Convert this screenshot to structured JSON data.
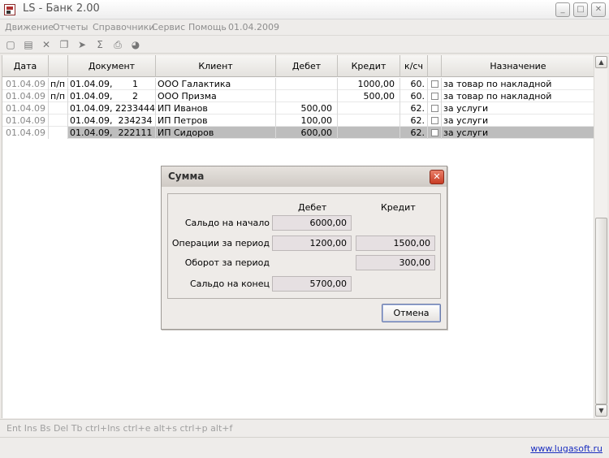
{
  "window": {
    "title": "LS - Банк 2.00",
    "min_label": "_",
    "max_label": "□",
    "close_label": "✕"
  },
  "menu": {
    "items": [
      "Движение",
      "Отчеты",
      "Справочники",
      "Сервис",
      "Помощь",
      "01.04.2009"
    ]
  },
  "toolbar": {
    "icons": [
      {
        "name": "new-document-icon",
        "glyph": "▢"
      },
      {
        "name": "open-folder-icon",
        "glyph": "▤"
      },
      {
        "name": "delete-icon",
        "glyph": "✕"
      },
      {
        "name": "copy-icon",
        "glyph": "❐"
      },
      {
        "name": "move-icon",
        "glyph": "➤"
      },
      {
        "name": "sum-icon",
        "glyph": "Σ"
      },
      {
        "name": "print-icon",
        "glyph": "⎙"
      },
      {
        "name": "chart-icon",
        "glyph": "◕"
      }
    ]
  },
  "table": {
    "columns": [
      "Дата",
      "",
      "Документ",
      "Клиент",
      "Дебет",
      "Кредит",
      "к/сч",
      "",
      "Назначение"
    ],
    "rows": [
      {
        "date": "01.04.09",
        "type": "п/п",
        "doc": "01.04.09,       1",
        "client": "ООО Галактика",
        "debit": "",
        "credit": "1000,00",
        "account": "60.",
        "purpose": "за товар по накладной",
        "selected": false
      },
      {
        "date": "01.04.09",
        "type": "п/п",
        "doc": "01.04.09,       2",
        "client": "ООО Призма",
        "debit": "",
        "credit": "500,00",
        "account": "60.",
        "purpose": "за товар по накладной",
        "selected": false
      },
      {
        "date": "01.04.09",
        "type": "",
        "doc": "01.04.09, 2233444",
        "client": "ИП Иванов",
        "debit": "500,00",
        "credit": "",
        "account": "62.",
        "purpose": "за услуги",
        "selected": false
      },
      {
        "date": "01.04.09",
        "type": "",
        "doc": "01.04.09,  234234",
        "client": "ИП Петров",
        "debit": "100,00",
        "credit": "",
        "account": "62.",
        "purpose": "за услуги",
        "selected": false
      },
      {
        "date": "01.04.09",
        "type": "",
        "doc": "01.04.09,  222111",
        "client": "ИП Сидоров",
        "debit": "600,00",
        "credit": "",
        "account": "62.",
        "purpose": "за услуги",
        "selected": true
      }
    ]
  },
  "scrollbar": {
    "up": "▲",
    "down": "▼"
  },
  "keys_hint": "Ent  Ins  Bs Del Tb ctrl+Ins ctrl+e  alt+s ctrl+p alt+f",
  "status": {
    "link": "www.lugasoft.ru"
  },
  "dialog": {
    "title": "Сумма",
    "close_label": "✕",
    "debit_header": "Дебет",
    "credit_header": "Кредит",
    "rows": [
      {
        "label": "Сальдо на начало",
        "debit": "6000,00",
        "credit": ""
      },
      {
        "label": "Операции за период",
        "debit": "1200,00",
        "credit": "1500,00"
      },
      {
        "label": "Оборот за период",
        "debit": "",
        "credit": "300,00"
      },
      {
        "label": "Сальдо на конец",
        "debit": "5700,00",
        "credit": ""
      }
    ],
    "cancel_label": "Отмена"
  }
}
